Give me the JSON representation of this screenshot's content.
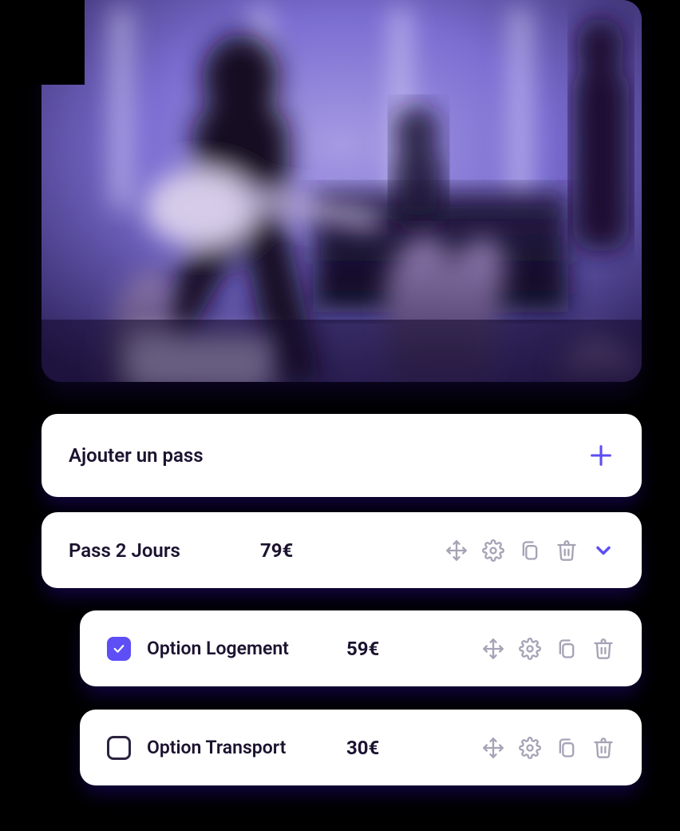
{
  "add_pass": {
    "label": "Ajouter un pass"
  },
  "pass": {
    "title": "Pass 2 Jours",
    "price": "79€"
  },
  "options": [
    {
      "label": "Option Logement",
      "price": "59€",
      "checked": true
    },
    {
      "label": "Option Transport",
      "price": "30€",
      "checked": false
    }
  ],
  "colors": {
    "accent": "#5d4ef5",
    "icon_muted": "#a7a3b6",
    "text": "#1c1330"
  }
}
